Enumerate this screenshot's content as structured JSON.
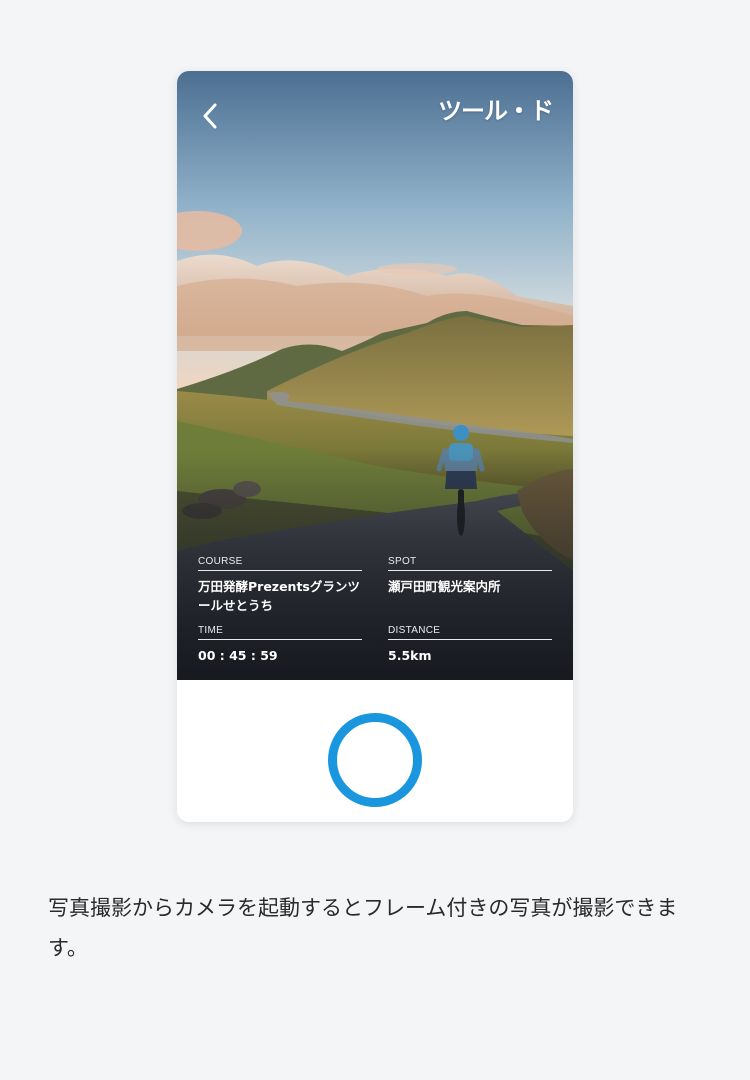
{
  "header": {
    "logo_text": "ツール・ド"
  },
  "info": {
    "course": {
      "label": "COURSE",
      "value": "万田発酵Prezentsグランツールせとうち"
    },
    "spot": {
      "label": "SPOT",
      "value": "瀬戸田町観光案内所"
    },
    "time": {
      "label": "TIME",
      "value": "00 : 45 : 59"
    },
    "distance": {
      "label": "DISTANCE",
      "value": "5.5km"
    }
  },
  "caption": "写真撮影からカメラを起動するとフレーム付きの写真が撮影できます。",
  "colors": {
    "accent": "#1a96de",
    "page_background": "#f4f5f7"
  },
  "icons": {
    "back": "chevron-left-icon",
    "shutter": "shutter-ring-icon"
  }
}
